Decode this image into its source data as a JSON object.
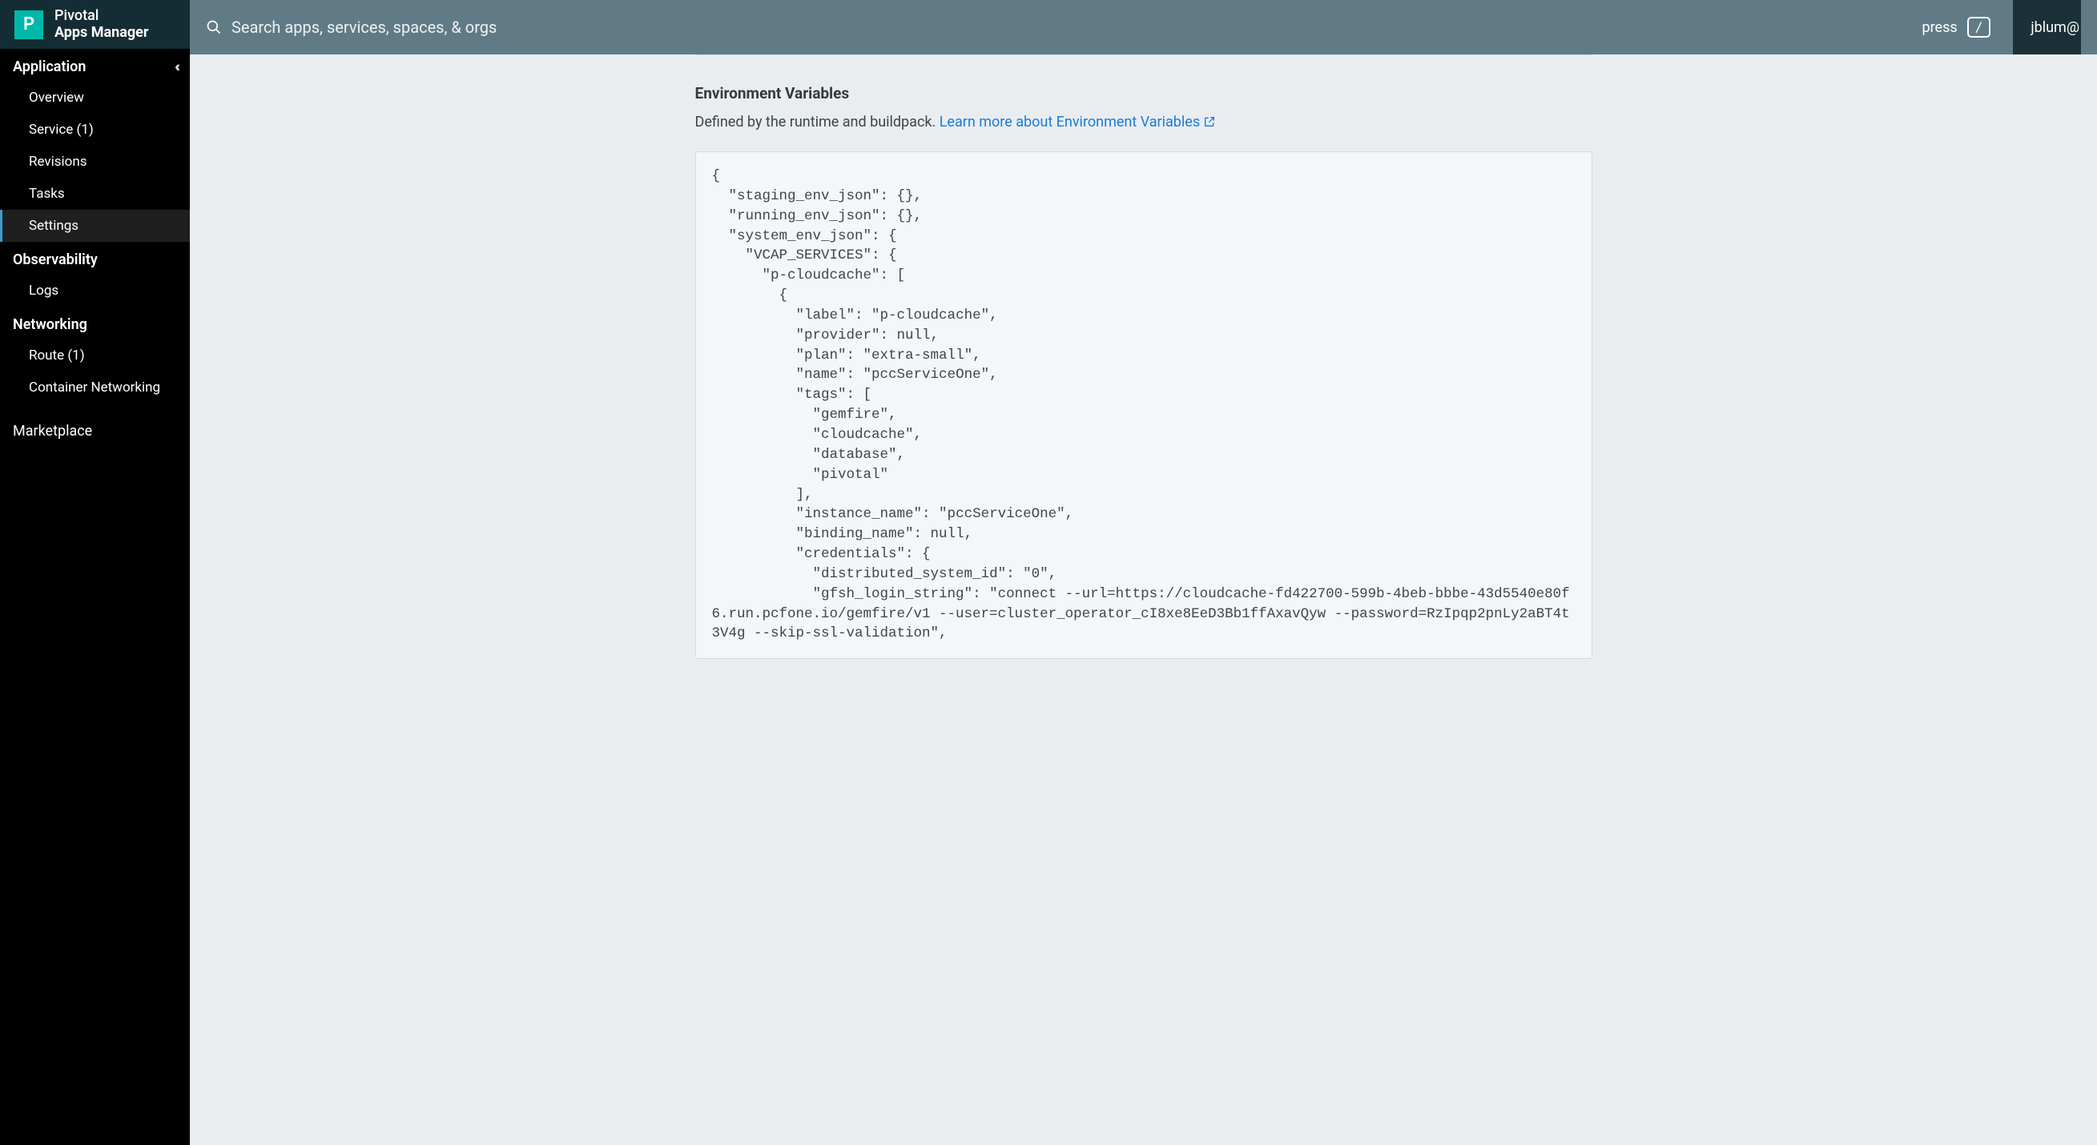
{
  "brand": {
    "logo_letter": "P",
    "line1": "Pivotal",
    "line2": "Apps Manager"
  },
  "topbar": {
    "search_placeholder": "Search apps, services, spaces, & orgs",
    "press_label": "press",
    "kbd": "/",
    "user": "jblum@"
  },
  "sidebar": {
    "sections": [
      {
        "header": "Application",
        "collapsible": true,
        "items": [
          {
            "label": "Overview",
            "active": false
          },
          {
            "label": "Service (1)",
            "active": false
          },
          {
            "label": "Revisions",
            "active": false
          },
          {
            "label": "Tasks",
            "active": false
          },
          {
            "label": "Settings",
            "active": true
          }
        ]
      },
      {
        "header": "Observability",
        "collapsible": false,
        "items": [
          {
            "label": "Logs",
            "active": false
          }
        ]
      },
      {
        "header": "Networking",
        "collapsible": false,
        "items": [
          {
            "label": "Route (1)",
            "active": false
          },
          {
            "label": "Container Networking",
            "active": false
          }
        ]
      }
    ],
    "bottom_item": "Marketplace"
  },
  "content": {
    "title": "Environment Variables",
    "subtitle_prefix": "Defined by the runtime and buildpack. ",
    "subtitle_link": "Learn more about Environment Variables",
    "code": "{\n  \"staging_env_json\": {},\n  \"running_env_json\": {},\n  \"system_env_json\": {\n    \"VCAP_SERVICES\": {\n      \"p-cloudcache\": [\n        {\n          \"label\": \"p-cloudcache\",\n          \"provider\": null,\n          \"plan\": \"extra-small\",\n          \"name\": \"pccServiceOne\",\n          \"tags\": [\n            \"gemfire\",\n            \"cloudcache\",\n            \"database\",\n            \"pivotal\"\n          ],\n          \"instance_name\": \"pccServiceOne\",\n          \"binding_name\": null,\n          \"credentials\": {\n            \"distributed_system_id\": \"0\",\n            \"gfsh_login_string\": \"connect --url=https://cloudcache-fd422700-599b-4beb-bbbe-43d5540e80f6.run.pcfone.io/gemfire/v1 --user=cluster_operator_cI8xe8EeD3Bb1ffAxavQyw --password=RzIpqp2pnLy2aBT4t3V4g --skip-ssl-validation\","
  }
}
